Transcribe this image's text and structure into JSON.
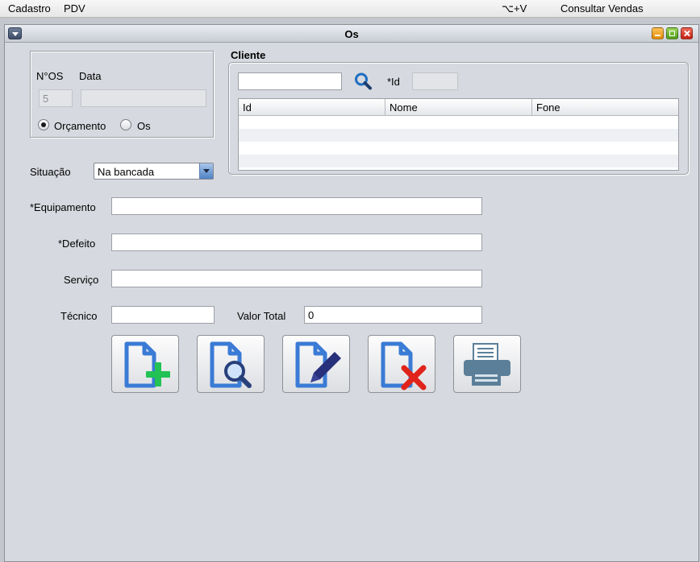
{
  "menubar": {
    "items": [
      "Cadastro",
      "PDV"
    ],
    "shortcut": "⌥+V",
    "consultar": "Consultar Vendas"
  },
  "window": {
    "title": "Os"
  },
  "os_panel": {
    "nos_label": "N°OS",
    "data_label": "Data",
    "nos_value": "5",
    "data_value": "",
    "radio_orcamento": "Orçamento",
    "radio_os": "Os",
    "selected": "Orçamento"
  },
  "cliente": {
    "title": "Cliente",
    "search_value": "",
    "id_label": "*Id",
    "id_value": "",
    "columns": [
      "Id",
      "Nome",
      "Fone"
    ]
  },
  "situacao": {
    "label": "Situação",
    "value": "Na bancada"
  },
  "form": {
    "equipamento_label": "*Equipamento",
    "equipamento_value": "",
    "defeito_label": "*Defeito",
    "defeito_value": "",
    "servico_label": "Serviço",
    "servico_value": "",
    "tecnico_label": "Técnico",
    "tecnico_value": "",
    "valor_label": "Valor Total",
    "valor_value": "0"
  },
  "actions": [
    "add-document-icon",
    "search-document-icon",
    "edit-document-icon",
    "delete-document-icon",
    "printer-icon"
  ],
  "colors": {
    "accent_blue": "#3a7bd5",
    "add_green": "#22c255",
    "delete_red": "#e0241b"
  }
}
